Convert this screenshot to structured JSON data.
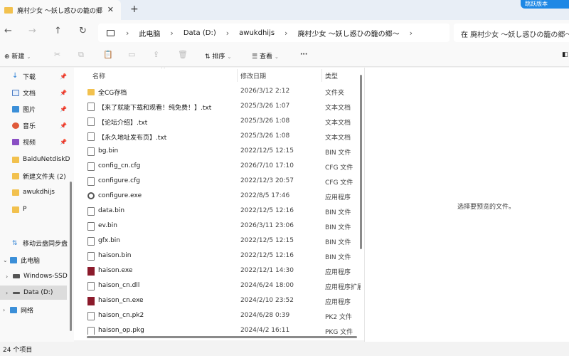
{
  "window": {
    "tab_title": "廃村少女 ～妖し惑ひの籠の郷",
    "tab_close": "✕",
    "new_tab": "+",
    "corner_badge": "跳跃版本"
  },
  "nav": {
    "back": "←",
    "forward": "→",
    "up": "↑",
    "refresh": "↻",
    "breadcrumb": [
      "此电脑",
      "Data (D:)",
      "awukdhijs",
      "廃村少女 ～妖し惑ひの籠の郷～"
    ],
    "separator": "›",
    "search_placeholder": "在 廃村少女 ～妖し惑ひの籠の郷～ 中搜索"
  },
  "commandbar": {
    "new_label": "新建",
    "sort_label": "排序",
    "view_label": "查看",
    "more_label": "···"
  },
  "sidebar": {
    "pinned": [
      {
        "label": "下载",
        "icon": "download-icon"
      },
      {
        "label": "文档",
        "icon": "document-icon"
      },
      {
        "label": "图片",
        "icon": "picture-icon"
      },
      {
        "label": "音乐",
        "icon": "music-icon"
      },
      {
        "label": "视频",
        "icon": "video-icon"
      }
    ],
    "folders": [
      "BaiduNetdiskD",
      "新建文件夹 (2)",
      "awukdhijs",
      "P"
    ],
    "cloud": "移动云盘同步盘",
    "this_pc": "此电脑",
    "drives": [
      "Windows-SSD",
      "Data (D:)"
    ],
    "network": "网络"
  },
  "columns": {
    "name": "名称",
    "date": "修改日期",
    "type": "类型"
  },
  "files": [
    {
      "name": "全CG存档",
      "date": "2026/3/12 2:12",
      "type": "文件夹",
      "icon": "folder"
    },
    {
      "name": "【来了就能下载和观看！纯免费！】.txt",
      "date": "2025/3/26 1:07",
      "type": "文本文档",
      "icon": "doc"
    },
    {
      "name": "【论坛介绍】.txt",
      "date": "2025/3/26 1:08",
      "type": "文本文档",
      "icon": "doc"
    },
    {
      "name": "【永久地址发布页】.txt",
      "date": "2025/3/26 1:08",
      "type": "文本文档",
      "icon": "doc"
    },
    {
      "name": "bg.bin",
      "date": "2022/12/5 12:15",
      "type": "BIN 文件",
      "icon": "doc"
    },
    {
      "name": "config_cn.cfg",
      "date": "2026/7/10 17:10",
      "type": "CFG 文件",
      "icon": "doc"
    },
    {
      "name": "configure.cfg",
      "date": "2022/12/3 20:57",
      "type": "CFG 文件",
      "icon": "doc"
    },
    {
      "name": "configure.exe",
      "date": "2022/8/5 17:46",
      "type": "应用程序",
      "icon": "gear"
    },
    {
      "name": "data.bin",
      "date": "2022/12/5 12:16",
      "type": "BIN 文件",
      "icon": "doc"
    },
    {
      "name": "ev.bin",
      "date": "2026/3/11 23:06",
      "type": "BIN 文件",
      "icon": "doc"
    },
    {
      "name": "gfx.bin",
      "date": "2022/12/5 12:15",
      "type": "BIN 文件",
      "icon": "doc"
    },
    {
      "name": "haison.bin",
      "date": "2022/12/5 12:16",
      "type": "BIN 文件",
      "icon": "doc"
    },
    {
      "name": "haison.exe",
      "date": "2022/12/1 14:30",
      "type": "应用程序",
      "icon": "exe-red"
    },
    {
      "name": "haison_cn.dll",
      "date": "2024/6/24 18:00",
      "type": "应用程序扩展",
      "icon": "doc"
    },
    {
      "name": "haison_cn.exe",
      "date": "2024/2/10 23:52",
      "type": "应用程序",
      "icon": "exe-red"
    },
    {
      "name": "haison_cn.pk2",
      "date": "2024/6/28 0:39",
      "type": "PK2 文件",
      "icon": "doc"
    },
    {
      "name": "haison_op.pkg",
      "date": "2024/4/2 16:11",
      "type": "PKG 文件",
      "icon": "doc"
    }
  ],
  "preview_message": "选择要预览的文件。",
  "status": "24 个项目"
}
